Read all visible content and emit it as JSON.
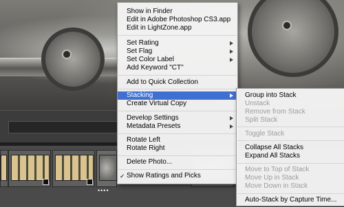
{
  "context_menu": {
    "items": [
      {
        "label": "Show in Finder"
      },
      {
        "label": "Edit in Adobe Photoshop CS3.app"
      },
      {
        "label": "Edit in LightZone.app"
      },
      {
        "label": "Set Rating"
      },
      {
        "label": "Set Flag"
      },
      {
        "label": "Set Color Label"
      },
      {
        "label": "Add Keyword \"CT\""
      },
      {
        "label": "Add to Quick Collection"
      },
      {
        "label": "Stacking"
      },
      {
        "label": "Create Virtual Copy"
      },
      {
        "label": "Develop Settings"
      },
      {
        "label": "Metadata Presets"
      },
      {
        "label": "Rotate Left"
      },
      {
        "label": "Rotate Right"
      },
      {
        "label": "Delete Photo..."
      },
      {
        "label": "Show Ratings and Picks",
        "checked": true,
        "check_glyph": "✓"
      }
    ]
  },
  "stacking_submenu": {
    "items": [
      {
        "label": "Group into Stack",
        "enabled": true
      },
      {
        "label": "Unstack",
        "enabled": false
      },
      {
        "label": "Remove from Stack",
        "enabled": false
      },
      {
        "label": "Split Stack",
        "enabled": false
      },
      {
        "label": "Toggle Stack",
        "enabled": false
      },
      {
        "label": "Collapse All Stacks",
        "enabled": true
      },
      {
        "label": "Expand All Stacks",
        "enabled": true
      },
      {
        "label": "Move to Top of Stack",
        "enabled": false
      },
      {
        "label": "Move Up in Stack",
        "enabled": false
      },
      {
        "label": "Move Down in Stack",
        "enabled": false
      },
      {
        "label": "Auto-Stack by Capture Time...",
        "enabled": true
      }
    ]
  },
  "filmstrip": {
    "rating_dots": "••••"
  },
  "colors": {
    "highlight": "#3f6fd1",
    "menu_bg": "#f4f4f4",
    "disabled_text": "#9c9c9c"
  }
}
